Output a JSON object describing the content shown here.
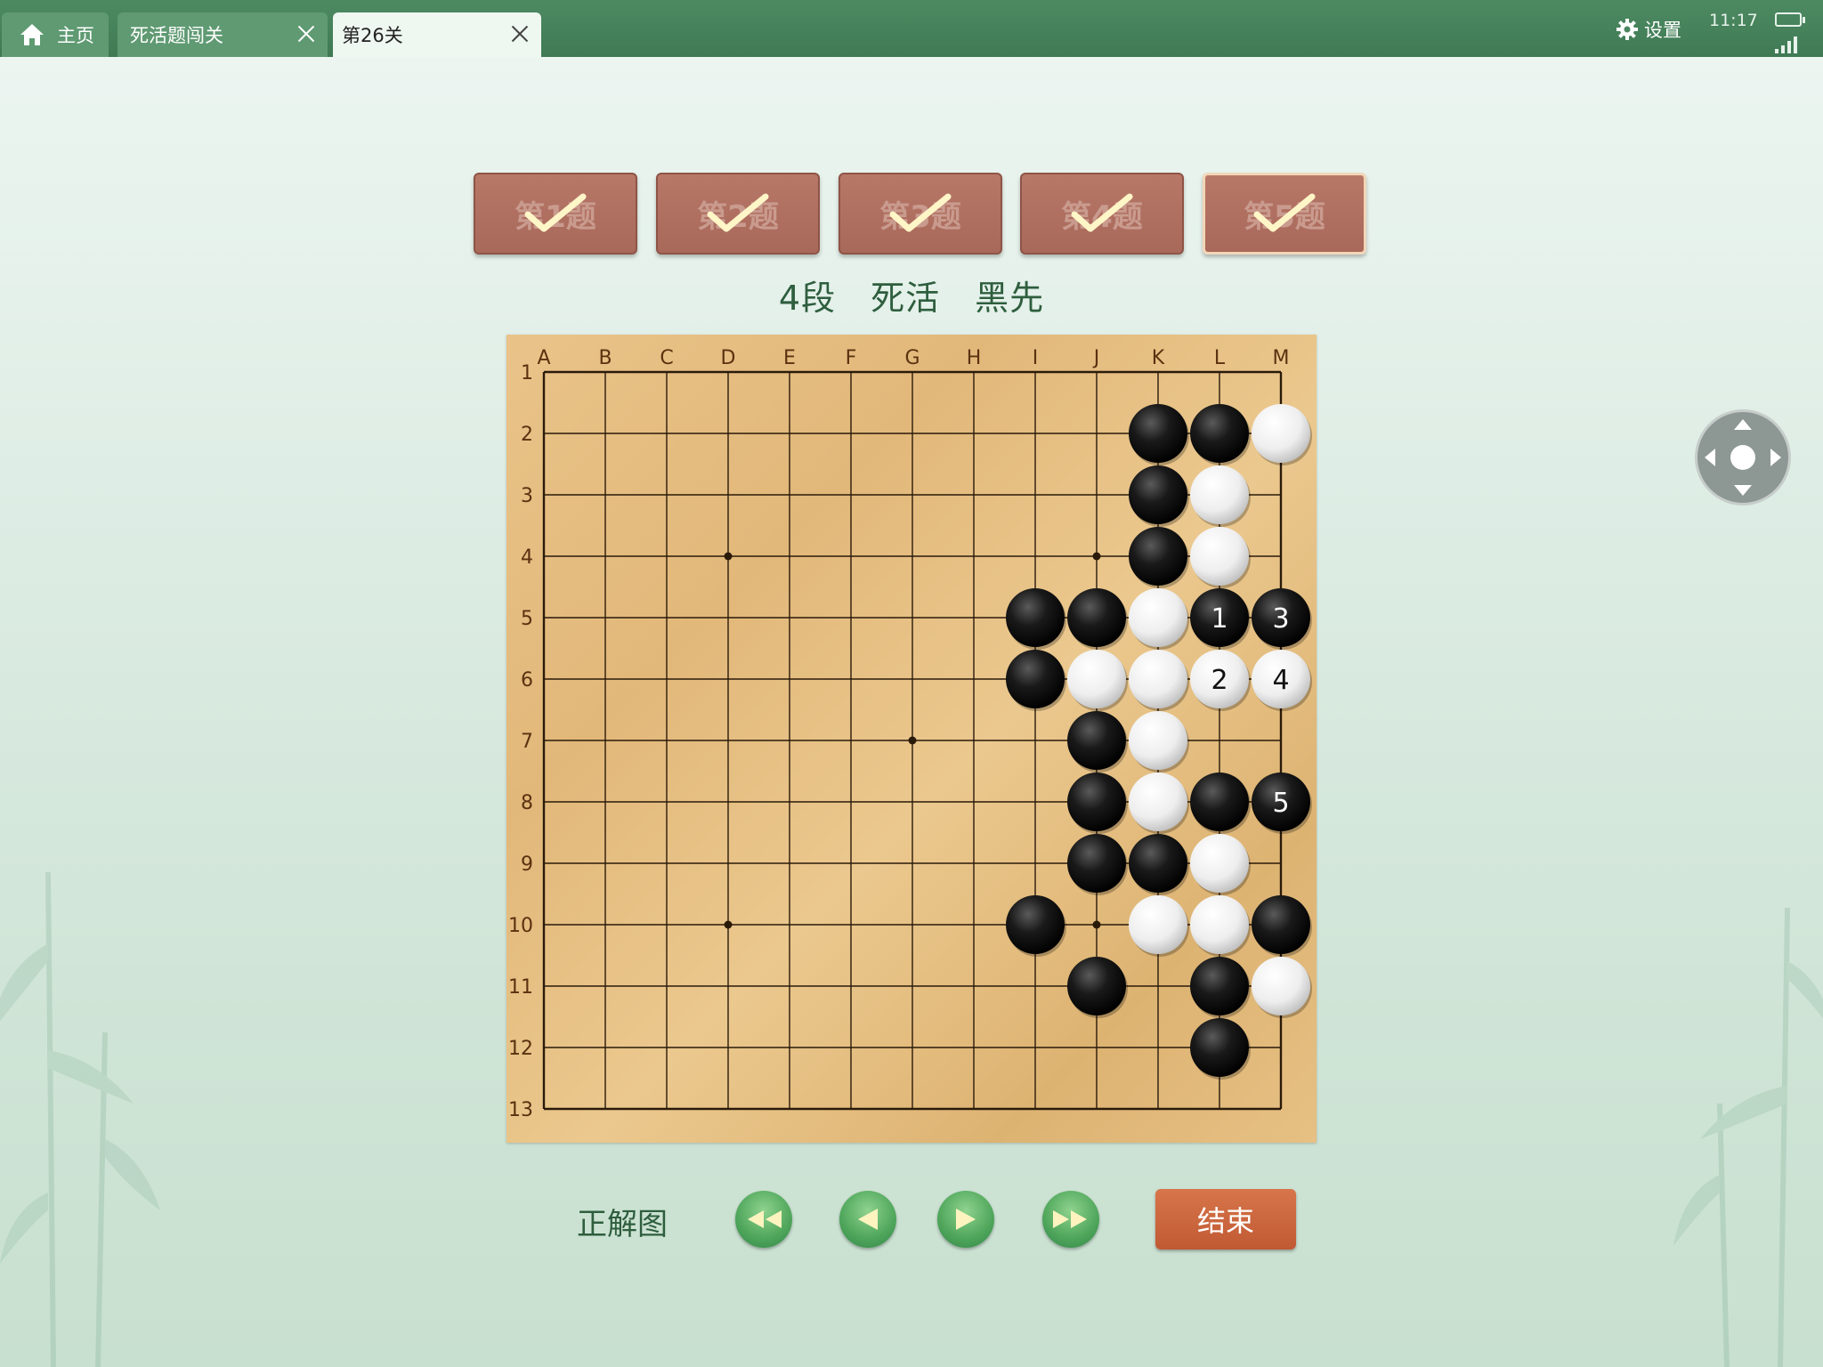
{
  "tabs": {
    "home_label": "主页",
    "tab1_label": "死活题闯关",
    "tab2_label": "第26关"
  },
  "status": {
    "settings_label": "设置",
    "time": "11:17"
  },
  "questions": [
    {
      "label": "第1题",
      "done": true
    },
    {
      "label": "第2题",
      "done": true
    },
    {
      "label": "第3题",
      "done": true
    },
    {
      "label": "第4题",
      "done": true
    },
    {
      "label": "第5题",
      "done": true,
      "active": true
    }
  ],
  "problem": {
    "title": "4段　死活　黑先"
  },
  "board": {
    "columns": [
      "A",
      "B",
      "C",
      "D",
      "E",
      "F",
      "G",
      "H",
      "I",
      "J",
      "K",
      "L",
      "M"
    ],
    "rows": [
      "1",
      "2",
      "3",
      "4",
      "5",
      "6",
      "7",
      "8",
      "9",
      "10",
      "11",
      "12",
      "13"
    ],
    "star_points": [
      "D4",
      "J4",
      "G7",
      "D10",
      "J10"
    ],
    "stones": [
      {
        "pos": "K2",
        "color": "black"
      },
      {
        "pos": "L2",
        "color": "black"
      },
      {
        "pos": "M2",
        "color": "white"
      },
      {
        "pos": "K3",
        "color": "black"
      },
      {
        "pos": "L3",
        "color": "white"
      },
      {
        "pos": "K4",
        "color": "black"
      },
      {
        "pos": "L4",
        "color": "white"
      },
      {
        "pos": "I5",
        "color": "black"
      },
      {
        "pos": "J5",
        "color": "black"
      },
      {
        "pos": "K5",
        "color": "white"
      },
      {
        "pos": "L5",
        "color": "black",
        "label": "1"
      },
      {
        "pos": "M5",
        "color": "black",
        "label": "3"
      },
      {
        "pos": "I6",
        "color": "black"
      },
      {
        "pos": "J6",
        "color": "white"
      },
      {
        "pos": "K6",
        "color": "white"
      },
      {
        "pos": "L6",
        "color": "white",
        "label": "2"
      },
      {
        "pos": "M6",
        "color": "white",
        "label": "4"
      },
      {
        "pos": "J7",
        "color": "black"
      },
      {
        "pos": "K7",
        "color": "white"
      },
      {
        "pos": "J8",
        "color": "black"
      },
      {
        "pos": "K8",
        "color": "white"
      },
      {
        "pos": "L8",
        "color": "black"
      },
      {
        "pos": "M8",
        "color": "black",
        "label": "5"
      },
      {
        "pos": "J9",
        "color": "black"
      },
      {
        "pos": "K9",
        "color": "black"
      },
      {
        "pos": "L9",
        "color": "white"
      },
      {
        "pos": "I10",
        "color": "black"
      },
      {
        "pos": "K10",
        "color": "white"
      },
      {
        "pos": "L10",
        "color": "white"
      },
      {
        "pos": "M10",
        "color": "black"
      },
      {
        "pos": "J11",
        "color": "black"
      },
      {
        "pos": "L11",
        "color": "black"
      },
      {
        "pos": "M11",
        "color": "white"
      },
      {
        "pos": "L12",
        "color": "black"
      }
    ]
  },
  "controls": {
    "answer_label": "正解图",
    "end_label": "结束"
  }
}
